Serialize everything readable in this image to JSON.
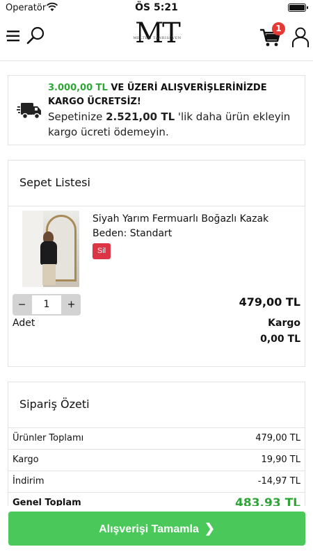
{
  "status_bar": {
    "carrier": "Operatör",
    "time": "ÖS 5:21"
  },
  "header": {
    "logo_mark": "MT",
    "logo_subtitle": "MELTEM TANRISEVEN",
    "cart_count": "1",
    "icons": [
      "menu-icon",
      "search-icon",
      "cart-icon",
      "user-icon"
    ]
  },
  "shipping": {
    "threshold": "3.000,00 TL",
    "headline": " VE ÜZERİ ALIŞVERİŞLERİNİZDE KARGO ÜCRETSİZ!",
    "prefix": "Sepetinize ",
    "remaining": "2.521,00 TL",
    "suffix": " 'lik daha ürün ekleyin kargo ücreti ödemeyin.",
    "icon": "truck-icon"
  },
  "cart": {
    "title": "Sepet Listesi",
    "items": [
      {
        "name": "Siyah Yarım Fermuarlı Boğazlı Kazak",
        "size": "Beden: Standart",
        "delete_label": "Sil",
        "quantity": "1",
        "quantity_label": "Adet",
        "price": "479,00 TL",
        "shipping_label": "Kargo",
        "shipping_value": "0,00 TL"
      }
    ]
  },
  "summary": {
    "title": "Sipariş Özeti",
    "rows": [
      {
        "label": "Ürünler Toplamı",
        "value": "479,00 TL"
      },
      {
        "label": "Kargo",
        "value": "19,90 TL"
      },
      {
        "label": "İndirim",
        "value": "-14,97 TL"
      },
      {
        "label": "Genel Toplam",
        "value": "483,93 TL"
      }
    ]
  },
  "checkout": {
    "label": "Alışverişi Tamamla"
  },
  "colors": {
    "accent_green": "#4ac95a",
    "text_green": "#2ea636",
    "danger": "#dc3545",
    "badge": "#e53935"
  }
}
